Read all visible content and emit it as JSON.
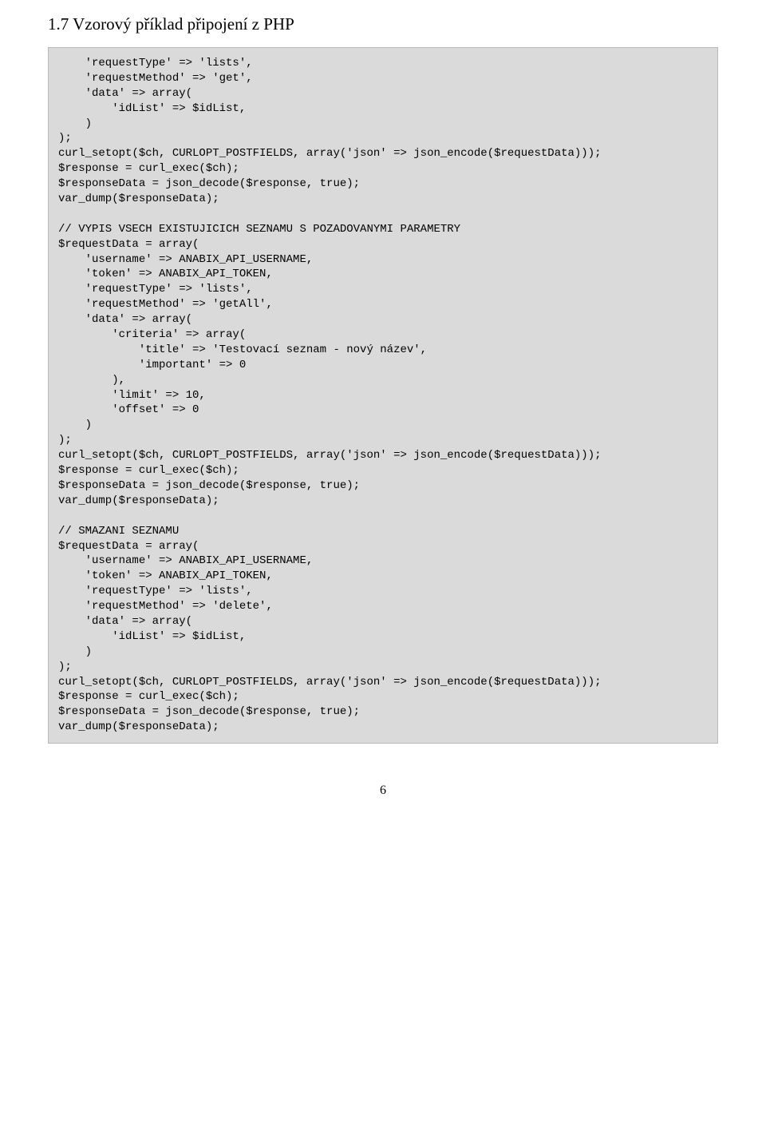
{
  "section_title": "1.7 Vzorový příklad připojení z PHP",
  "code": "    'requestType' => 'lists',\n    'requestMethod' => 'get',\n    'data' => array(\n        'idList' => $idList,\n    )\n);\ncurl_setopt($ch, CURLOPT_POSTFIELDS, array('json' => json_encode($requestData)));\n$response = curl_exec($ch);\n$responseData = json_decode($response, true);\nvar_dump($responseData);\n\n// VYPIS VSECH EXISTUJICICH SEZNAMU S POZADOVANYMI PARAMETRY\n$requestData = array(\n    'username' => ANABIX_API_USERNAME,\n    'token' => ANABIX_API_TOKEN,\n    'requestType' => 'lists',\n    'requestMethod' => 'getAll',\n    'data' => array(\n        'criteria' => array(\n            'title' => 'Testovací seznam - nový název',\n            'important' => 0\n        ),\n        'limit' => 10,\n        'offset' => 0\n    )\n);\ncurl_setopt($ch, CURLOPT_POSTFIELDS, array('json' => json_encode($requestData)));\n$response = curl_exec($ch);\n$responseData = json_decode($response, true);\nvar_dump($responseData);\n\n// SMAZANI SEZNAMU\n$requestData = array(\n    'username' => ANABIX_API_USERNAME,\n    'token' => ANABIX_API_TOKEN,\n    'requestType' => 'lists',\n    'requestMethod' => 'delete',\n    'data' => array(\n        'idList' => $idList,\n    )\n);\ncurl_setopt($ch, CURLOPT_POSTFIELDS, array('json' => json_encode($requestData)));\n$response = curl_exec($ch);\n$responseData = json_decode($response, true);\nvar_dump($responseData);",
  "page_number": "6"
}
